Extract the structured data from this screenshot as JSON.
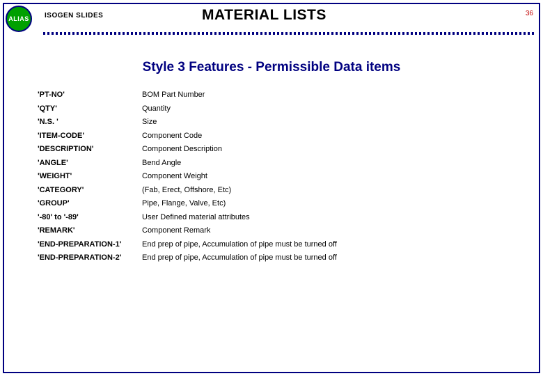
{
  "logo": {
    "text": "ALIAS"
  },
  "header": {
    "label": "ISOGEN SLIDES"
  },
  "title": "MATERIAL LISTS",
  "page_number": "36",
  "subtitle": "Style 3 Features - Permissible Data items",
  "items": [
    {
      "key": "'PT-NO'",
      "val": "BOM Part Number"
    },
    {
      "key": "'QTY'",
      "val": "Quantity"
    },
    {
      "key": "'N.S. '",
      "val": "Size"
    },
    {
      "key": "'ITEM-CODE'",
      "val": "Component Code"
    },
    {
      "key": "'DESCRIPTION'",
      "val": "Component Description"
    },
    {
      "key": "'ANGLE'",
      "val": "Bend Angle"
    },
    {
      "key": "'WEIGHT'",
      "val": "Component Weight"
    },
    {
      "key": "'CATEGORY'",
      "val": "(Fab, Erect, Offshore, Etc)"
    },
    {
      "key": "'GROUP'",
      "val": "Pipe, Flange, Valve, Etc)"
    },
    {
      "key": "'-80' to '-89'",
      "val": "User Defined material attributes"
    },
    {
      "key": "'REMARK'",
      "val": "Component Remark"
    },
    {
      "key": "'END-PREPARATION-1'",
      "val": "End prep of pipe, Accumulation of pipe must be turned off"
    },
    {
      "key": "'END-PREPARATION-2'",
      "val": "End prep of pipe, Accumulation of pipe must be turned off"
    }
  ]
}
